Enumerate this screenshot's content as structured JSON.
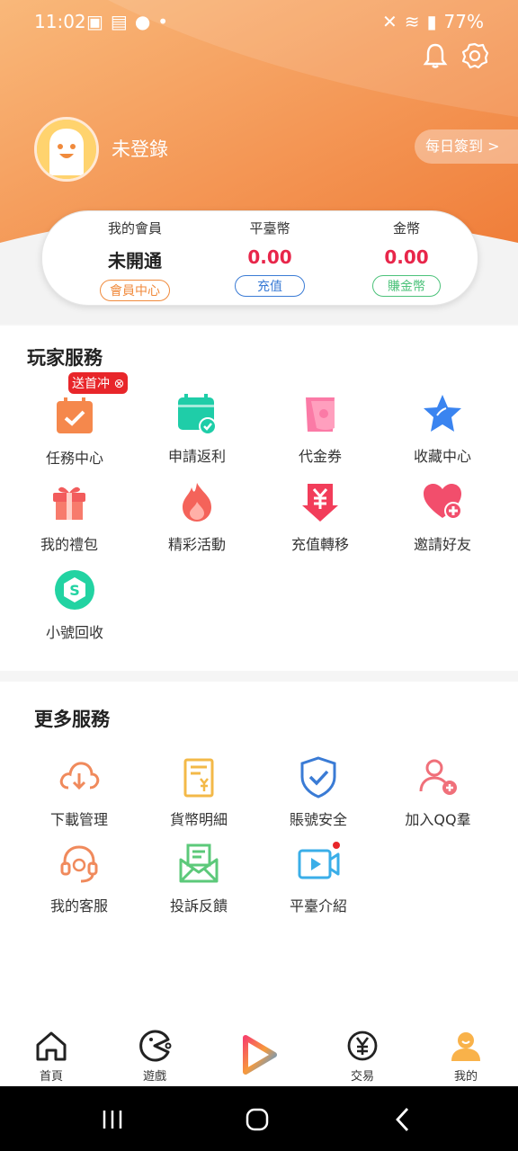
{
  "status": {
    "time": "11:02",
    "battery": "77%"
  },
  "icons": {
    "bell": "bell-icon",
    "settings": "gear-icon"
  },
  "profile": {
    "login_text": "未登錄",
    "checkin_label": "每日簽到 >"
  },
  "member": {
    "cols": [
      {
        "label": "我的會員",
        "value": "未開通",
        "button": "會員中心",
        "color": "#222",
        "btn_color": "#f08a3c"
      },
      {
        "label": "平臺幣",
        "value": "0.00",
        "button": "充值",
        "color": "#e8264a",
        "btn_color": "#3a7bd5"
      },
      {
        "label": "金幣",
        "value": "0.00",
        "button": "賺金幣",
        "color": "#e8264a",
        "btn_color": "#4cc27a"
      }
    ]
  },
  "player_services": {
    "title": "玩家服務",
    "badge": "送首冲",
    "items": [
      {
        "label": "任務中心",
        "icon": "task-icon"
      },
      {
        "label": "申請返利",
        "icon": "calendar-check-icon"
      },
      {
        "label": "代金券",
        "icon": "coupon-icon"
      },
      {
        "label": "收藏中心",
        "icon": "star-icon"
      },
      {
        "label": "我的禮包",
        "icon": "gift-icon"
      },
      {
        "label": "精彩活動",
        "icon": "flame-icon"
      },
      {
        "label": "充值轉移",
        "icon": "yen-transfer-icon"
      },
      {
        "label": "邀請好友",
        "icon": "heart-plus-icon"
      },
      {
        "label": "小號回收",
        "icon": "recycle-icon"
      }
    ]
  },
  "more_services": {
    "title": "更多服務",
    "items": [
      {
        "label": "下載管理",
        "icon": "cloud-download-icon"
      },
      {
        "label": "貨幣明細",
        "icon": "receipt-icon"
      },
      {
        "label": "賬號安全",
        "icon": "shield-check-icon"
      },
      {
        "label": "加入QQ羣",
        "icon": "add-user-icon"
      },
      {
        "label": "我的客服",
        "icon": "headset-icon"
      },
      {
        "label": "投訴反饋",
        "icon": "mail-icon"
      },
      {
        "label": "平臺介紹",
        "icon": "video-icon"
      }
    ]
  },
  "tabbar": {
    "items": [
      {
        "label": "首頁",
        "icon": "home-icon"
      },
      {
        "label": "遊戲",
        "icon": "game-icon"
      },
      {
        "label": "",
        "icon": "play-logo-icon"
      },
      {
        "label": "交易",
        "icon": "yen-circle-icon"
      },
      {
        "label": "我的",
        "icon": "user-icon"
      }
    ]
  }
}
